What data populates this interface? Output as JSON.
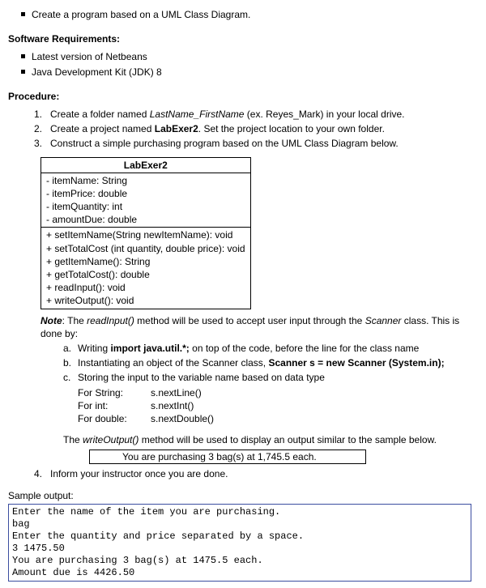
{
  "top_bullet": "Create a program based on a UML Class Diagram.",
  "req_heading": "Software Requirements:",
  "reqs": [
    "Latest version of Netbeans",
    "Java Development Kit (JDK) 8"
  ],
  "proc_heading": "Procedure:",
  "proc": {
    "p1_a": "Create a folder named ",
    "p1_i": "LastName_FirstName",
    "p1_b": " (ex. Reyes_Mark) in your local drive.",
    "p2_a": "Create a project named ",
    "p2_b": "LabExer2",
    "p2_c": ". Set the project location to your own folder.",
    "p3": "Construct a simple purchasing program based on the UML Class Diagram below."
  },
  "uml": {
    "title": "LabExer2",
    "attrs": [
      "-   itemName: String",
      "-   itemPrice: double",
      "-   itemQuantity: int",
      "-   amountDue: double"
    ],
    "methods": [
      "+   setItemName(String newItemName): void",
      "+   setTotalCost (int quantity, double price): void",
      "+   getItemName(): String",
      "+   getTotalCost(): double",
      "+   readInput(): void",
      "+   writeOutput(): void"
    ]
  },
  "note": {
    "label": "Note",
    "t1": ":    The ",
    "m1": "readInput()",
    "t2": " method will be used to accept user input through the ",
    "m2": "Scanner",
    "t3": " class. This is done by:",
    "a1": "Writing ",
    "a1b": "import java.util.*;",
    "a1c": " on top of the code, before the line for the class name",
    "b1": "Instantiating an object of the Scanner class, ",
    "b1b": "Scanner s = new Scanner (System.in);",
    "c1": "Storing the input to the variable name based on data type",
    "for_str_l": "For String:",
    "for_str_v": "s.nextLine()",
    "for_int_l": "For int:",
    "for_int_v": "s.nextInt()",
    "for_dbl_l": "For double:",
    "for_dbl_v": "s.nextDouble()",
    "w1": "The ",
    "w1i": "writeOutput()",
    "w1b": " method will be used to display an output similar to the sample below.",
    "box": "You are purchasing 3 bag(s) at 1,745.5 each."
  },
  "p4": "Inform your instructor once you are done.",
  "sample_h": "Sample output:",
  "sample": "Enter the name of the item you are purchasing.\nbag\nEnter the quantity and price separated by a space.\n3 1475.50\nYou are purchasing 3 bag(s) at 1475.5 each.\nAmount due is 4426.50"
}
